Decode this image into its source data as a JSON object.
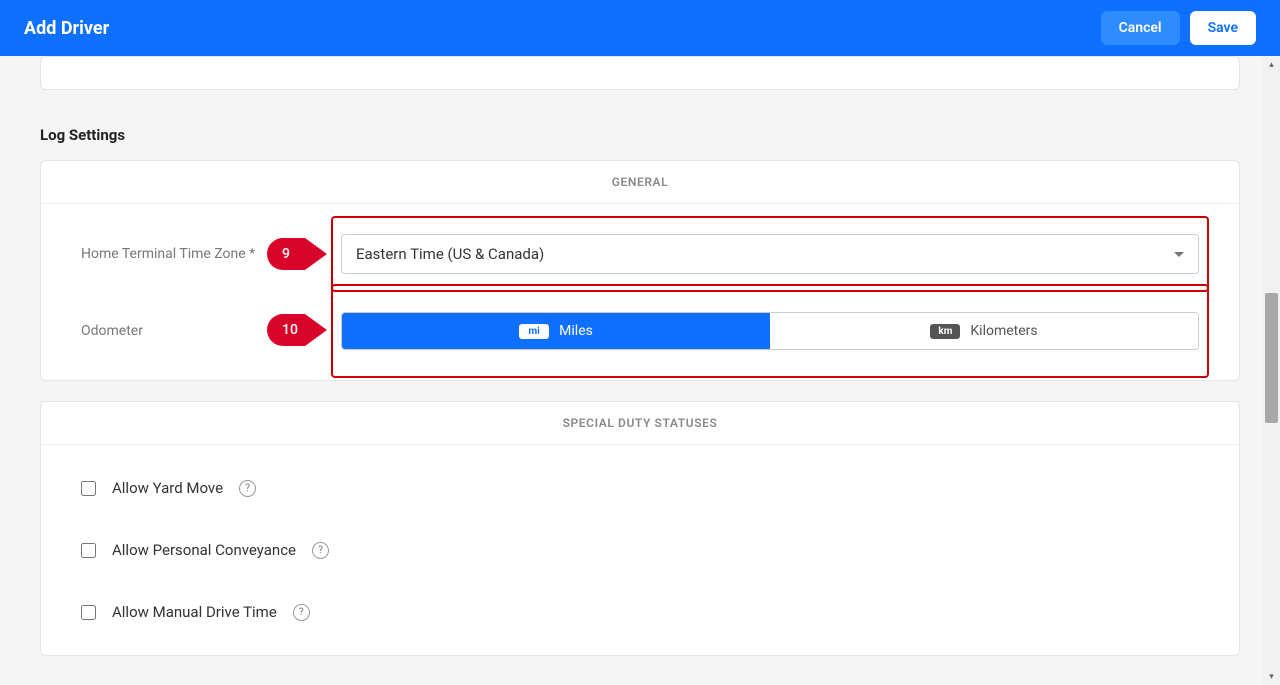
{
  "header": {
    "title": "Add Driver",
    "cancel_label": "Cancel",
    "save_label": "Save"
  },
  "log_settings": {
    "section_title": "Log Settings",
    "general_header": "GENERAL",
    "timezone_label": "Home Terminal Time Zone *",
    "timezone_value": "Eastern Time (US & Canada)",
    "odometer_label": "Odometer",
    "odometer_miles_badge": "mi",
    "odometer_miles_label": "Miles",
    "odometer_km_badge": "km",
    "odometer_km_label": "Kilometers"
  },
  "special_duty": {
    "header": "SPECIAL DUTY STATUSES",
    "yard_move_label": "Allow Yard Move",
    "personal_conveyance_label": "Allow Personal Conveyance",
    "manual_drive_label": "Allow Manual Drive Time"
  },
  "annotations": {
    "n9": "9",
    "n10": "10"
  }
}
